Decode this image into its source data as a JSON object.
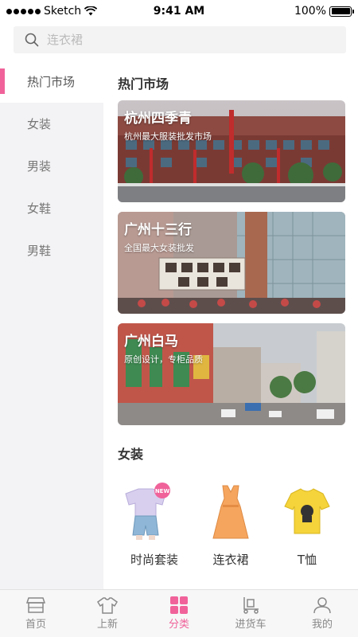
{
  "status_bar": {
    "carrier": "Sketch",
    "time": "9:41 AM",
    "battery": "100%",
    "battery_level": 1.0
  },
  "search": {
    "placeholder": "连衣裙",
    "icon": "search-icon"
  },
  "sidebar": {
    "items": [
      {
        "label": "热门市场",
        "active": true
      },
      {
        "label": "女装",
        "active": false
      },
      {
        "label": "男装",
        "active": false
      },
      {
        "label": "女鞋",
        "active": false
      },
      {
        "label": "男鞋",
        "active": false
      }
    ]
  },
  "main": {
    "hot_title": "热门市场",
    "markets": [
      {
        "name": "杭州四季青",
        "desc": "杭州最大服装批发市场"
      },
      {
        "name": "广州十三行",
        "desc": "全国最大女装批发"
      },
      {
        "name": "广州白马",
        "desc": "原创设计，专柜品质"
      }
    ],
    "women_title": "女装",
    "products": [
      {
        "name": "时尚套装",
        "badge": "NEW"
      },
      {
        "name": "连衣裙"
      },
      {
        "name": "T恤"
      }
    ]
  },
  "tabbar": {
    "items": [
      {
        "label": "首页",
        "icon": "store-icon"
      },
      {
        "label": "上新",
        "icon": "shirt-icon"
      },
      {
        "label": "分类",
        "icon": "category-grid-icon",
        "active": true
      },
      {
        "label": "进货车",
        "icon": "cart-icon"
      },
      {
        "label": "我的",
        "icon": "user-icon"
      }
    ]
  },
  "colors": {
    "accent": "#f0629a",
    "sidebar_bg": "#f3f3f5"
  }
}
